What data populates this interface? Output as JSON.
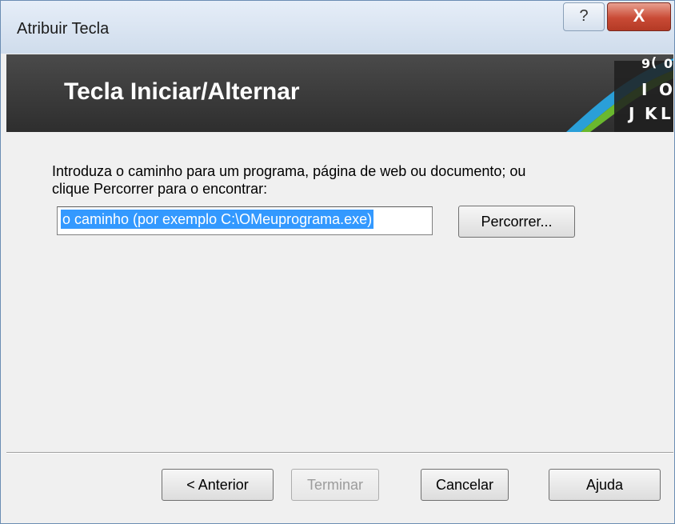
{
  "window": {
    "title": "Atribuir Tecla",
    "help_glyph": "?",
    "close_glyph": "X"
  },
  "banner": {
    "title": "Tecla Iniciar/Alternar",
    "key_glyphs": [
      "9",
      "(",
      "0",
      "I",
      "O",
      "J",
      "K",
      "L"
    ]
  },
  "content": {
    "instruction_line1": "Introduza o caminho para um programa, página de web ou documento; ou",
    "instruction_line2": "clique Percorrer para o encontrar:",
    "path_value": "o caminho (por exemplo C:\\OMeuprograma.exe)",
    "browse_label": "Percorrer..."
  },
  "footer": {
    "back_label": "< Anterior",
    "finish_label": "Terminar",
    "cancel_label": "Cancelar",
    "help_label": "Ajuda"
  },
  "colors": {
    "banner_bg": "#3a3a3a",
    "accent_blue": "#2a9fd8",
    "accent_green": "#6ab82e",
    "selection": "#3399ff",
    "close_red": "#c94a35"
  }
}
